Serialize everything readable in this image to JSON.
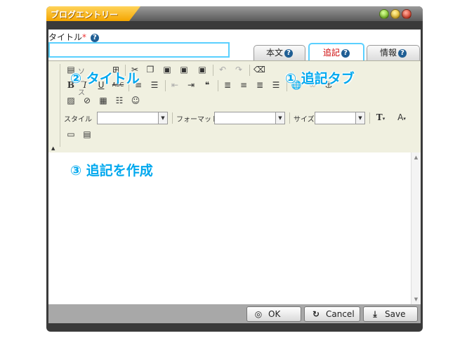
{
  "window": {
    "title": "ブログエントリー",
    "controls": [
      "minimize",
      "maximize",
      "close"
    ]
  },
  "entry": {
    "title_label": "タイトル",
    "required_mark": "*",
    "title_value": "",
    "help_glyph": "?"
  },
  "tabs": [
    {
      "label": "本文",
      "active": false
    },
    {
      "label": "追記",
      "active": true
    },
    {
      "label": "情報",
      "active": false
    }
  ],
  "toolbar": {
    "row1": [
      "source-icon",
      "preview-icon",
      "cut-icon",
      "copy-icon",
      "paste-icon",
      "paste-text-icon",
      "paste-word-icon",
      "undo-icon",
      "redo-icon",
      "eraser-icon"
    ],
    "row1_first_label": "ソース",
    "row2": [
      "bold-icon",
      "italic-icon",
      "underline-icon",
      "strikethrough-icon",
      "ordered-list-icon",
      "unordered-list-icon",
      "outdent-icon",
      "indent-icon",
      "blockquote-icon",
      "align-left-icon",
      "align-center-icon",
      "align-right-icon",
      "align-justify-icon",
      "link-icon",
      "unlink-icon",
      "anchor-icon"
    ],
    "row2_labels": {
      "bold": "B",
      "italic": "I",
      "underline": "U",
      "strike": "ABC"
    },
    "row3": [
      "image-icon",
      "flash-icon",
      "table-icon",
      "horizontal-rule-icon",
      "smiley-icon"
    ],
    "row4": {
      "style_label": "スタイル",
      "format_label": "フォーマット",
      "size_label": "サイズ",
      "style_value": "",
      "format_value": "",
      "size_value": "",
      "text_color_label": "T",
      "bg_color_label": "A"
    },
    "row5": [
      "show-blocks-icon",
      "template-icon"
    ]
  },
  "editor": {
    "content": ""
  },
  "buttons": {
    "ok": "OK",
    "cancel": "Cancel",
    "save": "Save"
  },
  "annotations": {
    "tab": "① 追記タブ",
    "title": "② タイトル",
    "create": "③ 追記を作成"
  },
  "colors": {
    "annotation": "#00a8ee",
    "active_tab_border": "#5ad0ff",
    "active_tab_text": "#cc0000",
    "title_tab": "#f4a500"
  }
}
